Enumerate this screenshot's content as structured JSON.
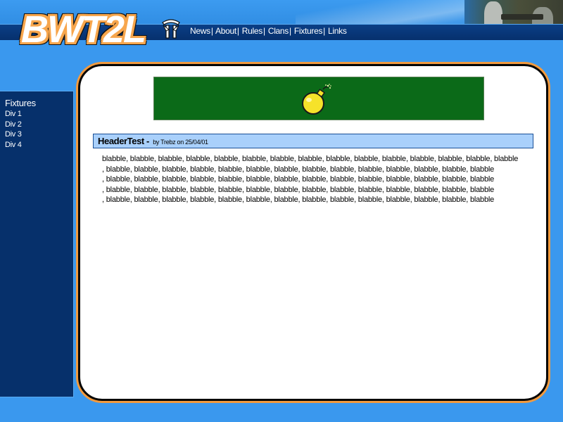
{
  "site": {
    "logo_text": "BWT2L",
    "colors": {
      "background": "#3a98ee",
      "sidebar": "#06306b",
      "banner": "#0b6a18",
      "accent_border": "#f29a3e",
      "post_header": "#a9d0fb"
    }
  },
  "nav": {
    "items": [
      {
        "label": "News"
      },
      {
        "label": "About"
      },
      {
        "label": "Rules"
      },
      {
        "label": "Clans"
      },
      {
        "label": "Fixtures"
      },
      {
        "label": "Links"
      }
    ],
    "separator": "|"
  },
  "sidebar": {
    "heading": "Fixtures",
    "items": [
      {
        "label": "Div 1"
      },
      {
        "label": "Div 2"
      },
      {
        "label": "Div 3"
      },
      {
        "label": "Div 4"
      }
    ]
  },
  "banner": {
    "icon": "bomb-icon"
  },
  "post": {
    "title": "HeaderTest -",
    "meta": "by Trebz on 25/04/01",
    "lines": [
      "blabble, blabble, blabble, blabble, blabble, blabble, blabble, blabble, blabble, blabble, blabble, blabble, blabble, blabble, blabble",
      ", blabble, blabble, blabble, blabble, blabble, blabble, blabble, blabble, blabble, blabble, blabble, blabble, blabble, blabble",
      ", blabble, blabble, blabble, blabble, blabble, blabble, blabble, blabble, blabble, blabble, blabble, blabble, blabble, blabble",
      ", blabble, blabble, blabble, blabble, blabble, blabble, blabble, blabble, blabble, blabble, blabble, blabble, blabble, blabble",
      ", blabble, blabble, blabble, blabble, blabble, blabble, blabble, blabble, blabble, blabble, blabble, blabble, blabble, blabble"
    ]
  }
}
